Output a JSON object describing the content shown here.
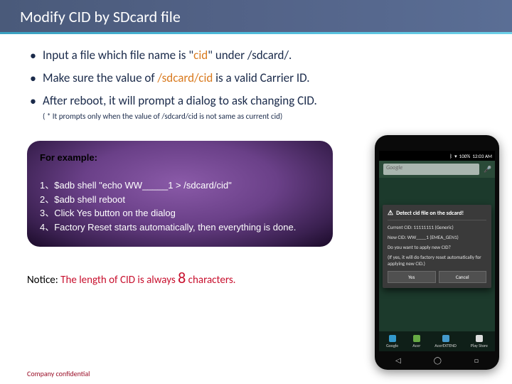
{
  "title": "Modify CID by SDcard file",
  "bullets": {
    "b1_pre": "Input a file which file name is \"",
    "b1_cid": "cid",
    "b1_post": "\" under /sdcard/.",
    "b2_pre": "Make sure the value of ",
    "b2_path": "/sdcard/cid",
    "b2_post": " is a valid Carrier ID.",
    "b3": "After reboot, it will prompt a dialog to ask changing CID."
  },
  "footnote": "( * It prompts only when the value of /sdcard/cid is not same as current cid)",
  "example": {
    "heading": "For example:",
    "l1": "1、$adb shell \"echo WW_____1 > /sdcard/cid\"",
    "l2": "2、$adb shell reboot",
    "l3": "3、Click Yes button on the dialog",
    "l4": "4、Factory Reset starts automatically, then everything is done."
  },
  "notice": {
    "label": "Notice:",
    "pre": " The length of CID is always ",
    "eight": "8",
    "post": " characters."
  },
  "footer": "Company confidential",
  "phone": {
    "status": {
      "bt": "ᛒ",
      "wifi": "▾",
      "batt": "100%",
      "time": "12:03 AM"
    },
    "search_placeholder": "Google",
    "dialog": {
      "title": "Detect cid file on the sdcard!",
      "line1": "Current CID: 11111111 (Generic)",
      "line2": "New CID: WW____1 (EMEA_GEN1)",
      "q": "Do you want to apply new CID?",
      "hint": "(If yes, it will do factory reset automatically for applying new CID.)",
      "yes": "Yes",
      "cancel": "Cancel"
    },
    "dock": {
      "a": "Google",
      "b": "Acer",
      "c": "AcerEXTEND",
      "d": "Play Store"
    }
  }
}
